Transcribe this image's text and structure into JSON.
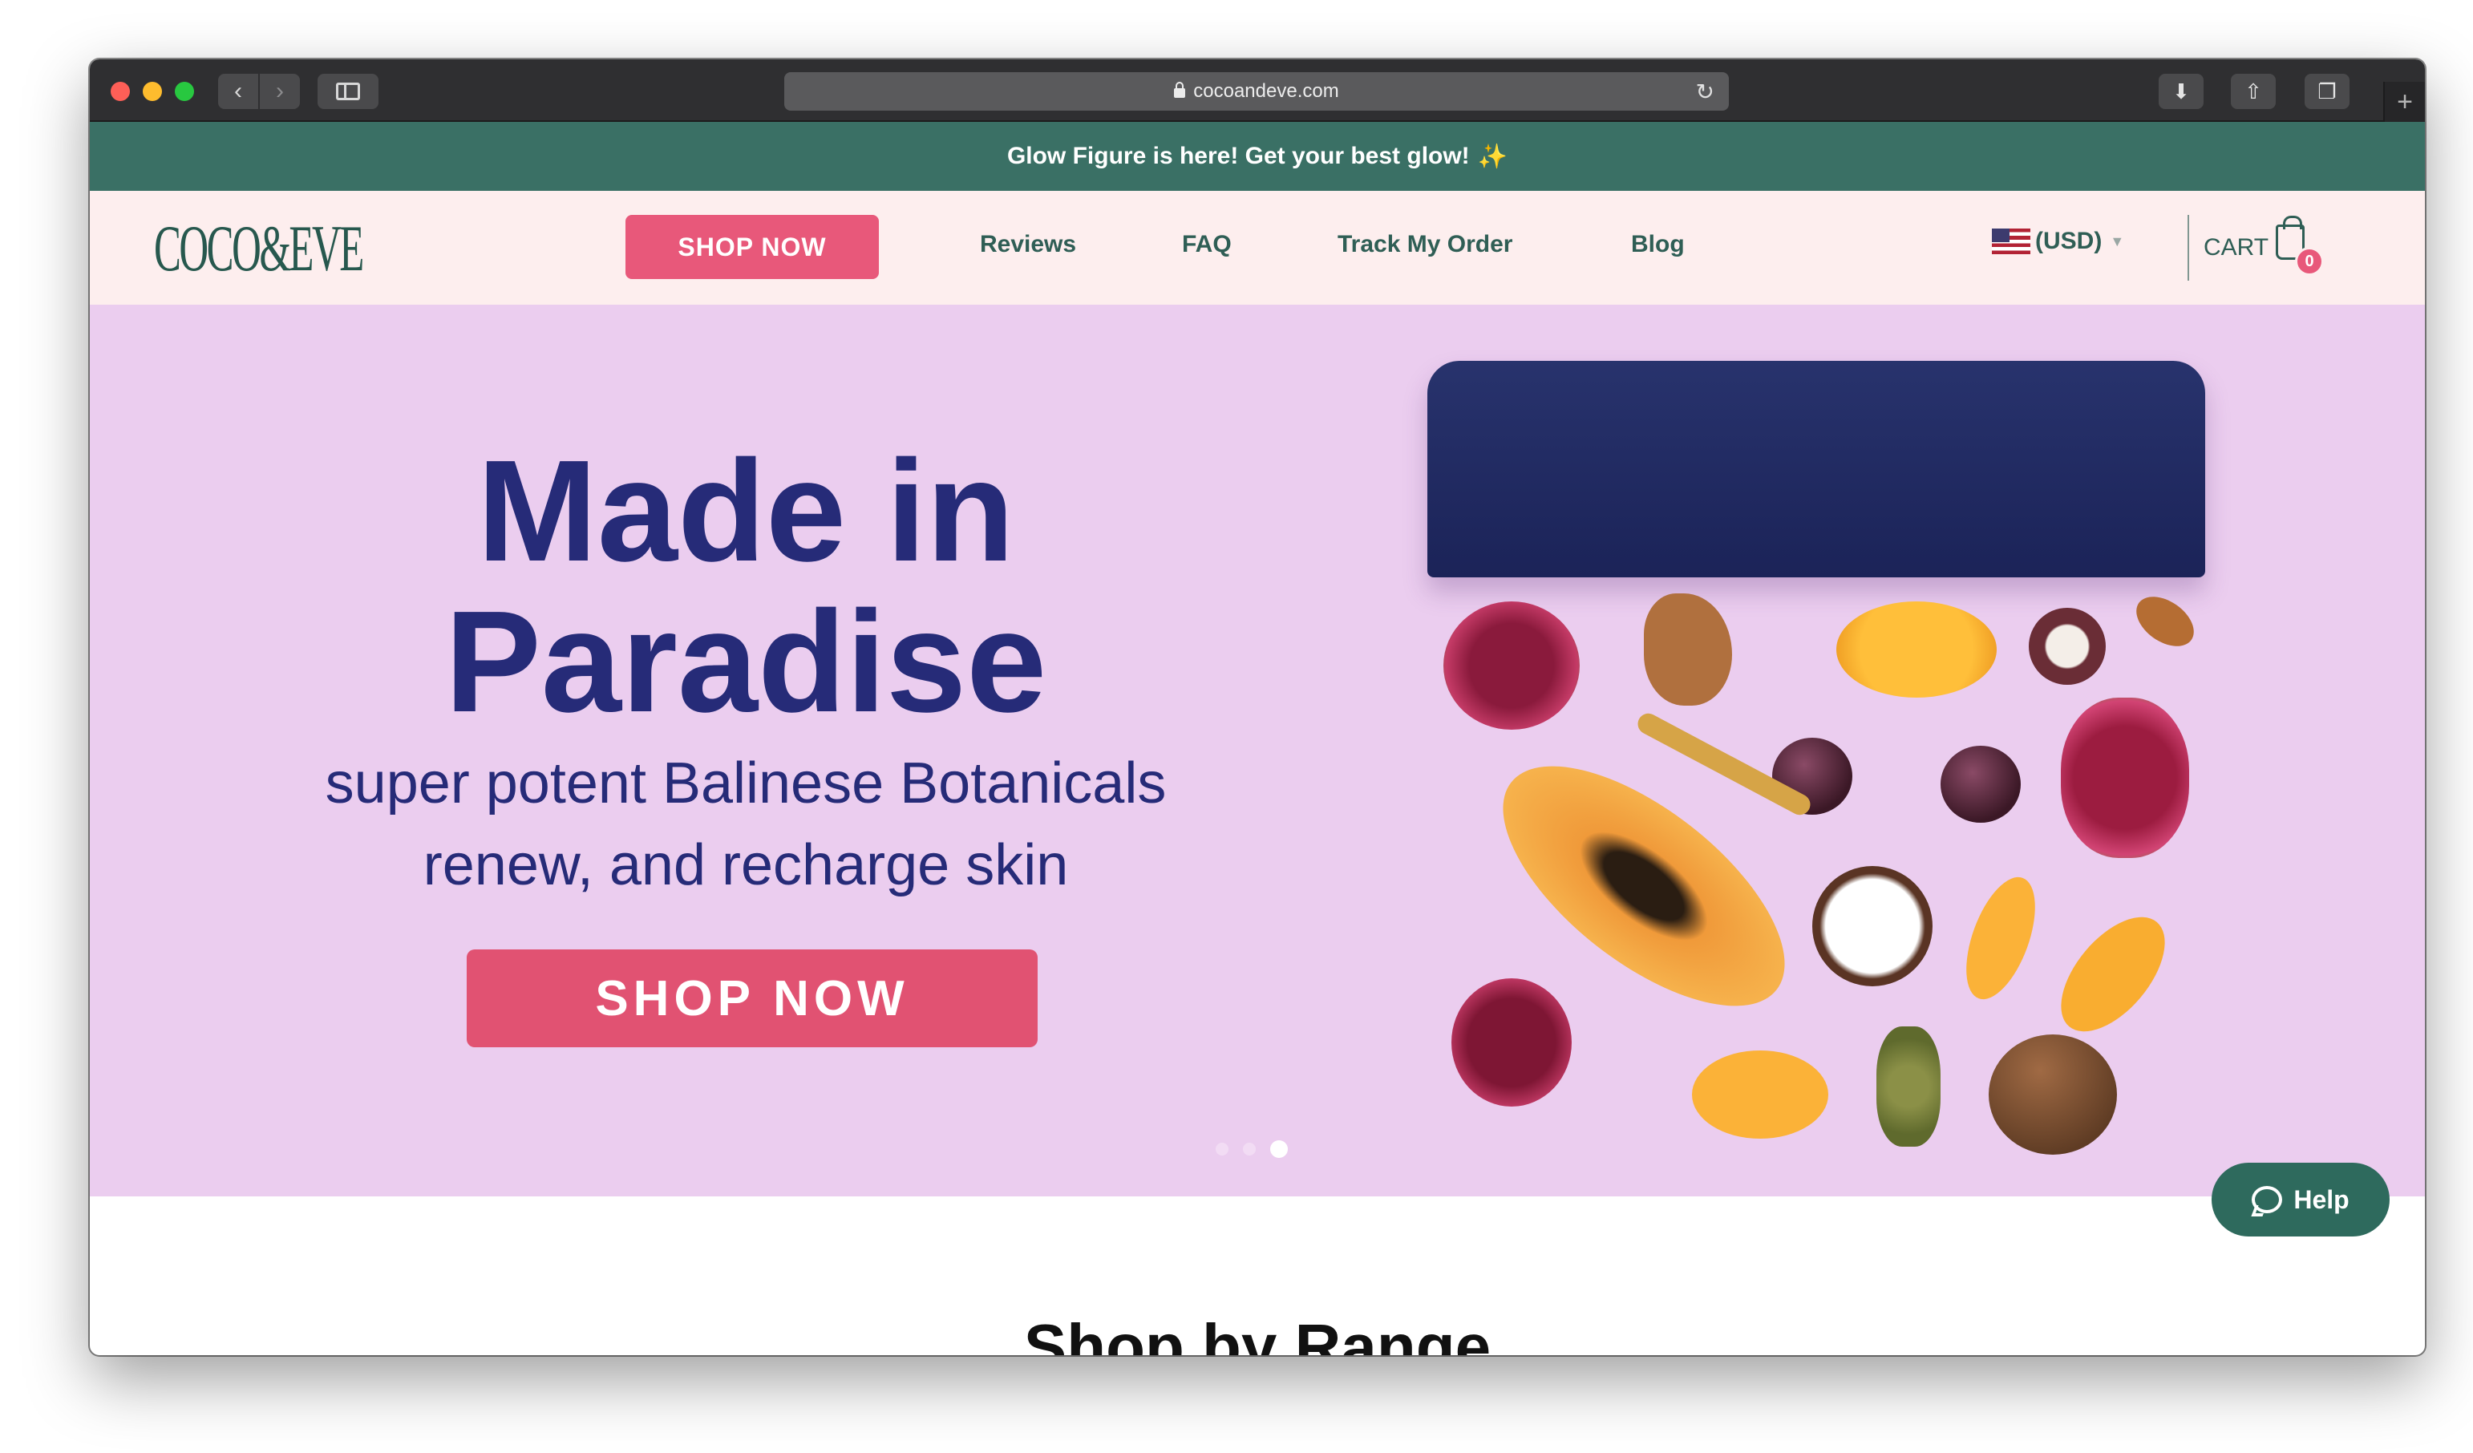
{
  "browser": {
    "url": "cocoandeve.com"
  },
  "announcement": {
    "text": "Glow Figure is here! Get your best glow!",
    "emoji": "✨"
  },
  "header": {
    "logo": "COCO&EVE",
    "shop_button": "SHOP NOW",
    "nav": [
      "Reviews",
      "FAQ",
      "Track My Order",
      "Blog"
    ],
    "currency": "(USD)",
    "cart_label": "CART",
    "cart_count": "0"
  },
  "hero": {
    "title_line1": "Made in",
    "title_line2": "Paradise",
    "subtitle_line1": "super potent Balinese Botanicals",
    "subtitle_line2": "renew, and recharge skin",
    "cta": "SHOP NOW",
    "carousel": {
      "slides": 3,
      "active": 3
    }
  },
  "section": {
    "title": "Shop by Range"
  },
  "help": {
    "label": "Help"
  },
  "colors": {
    "announce_bg": "#3a7065",
    "header_bg": "#fdeeee",
    "accent_pink": "#e8587a",
    "hero_bg": "#ebcdef",
    "hero_text": "#262b78",
    "help_bg": "#2e6a5d"
  }
}
